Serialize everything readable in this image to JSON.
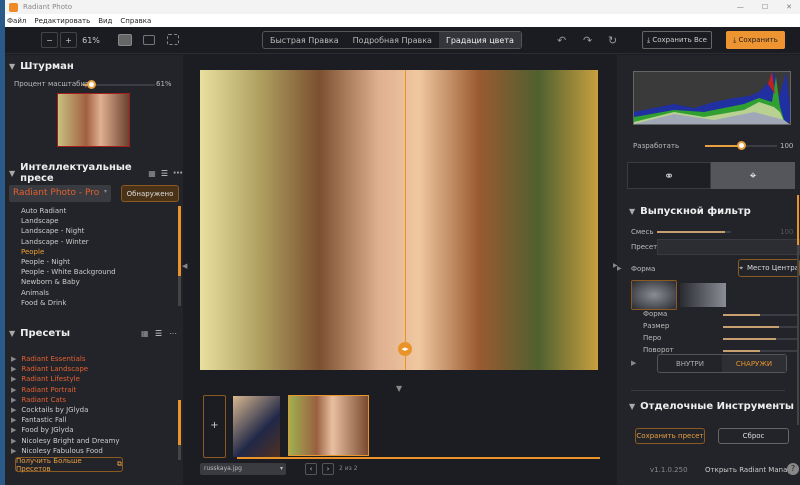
{
  "window": {
    "title": "Radiant Photo",
    "controls": [
      "—",
      "☐",
      "✕"
    ]
  },
  "menu": [
    "Файл",
    "Редактировать",
    "Вид",
    "Справка"
  ],
  "toolbar": {
    "zoom_out": "−",
    "zoom_in": "+",
    "zoom": "61%",
    "modes": [
      "Быстрая Правка",
      "Подробная Правка",
      "Градация цвета"
    ],
    "active_mode": 2,
    "save_all": "⤓ Сохранить Все",
    "save": "⤓ Сохранить"
  },
  "navigator": {
    "title": "Штурман",
    "zoom_label": "Процент масштабир",
    "zoom_value": "61%",
    "zoom_percent": 61
  },
  "smart_presets": {
    "title": "Интеллектуальные пресе",
    "dropdown": "Radiant Photo - Pro",
    "detected": "Обнаружено",
    "items": [
      "Auto Radiant",
      "Landscape",
      "Landscape - Night",
      "Landscape - Winter",
      "People",
      "People - Night",
      "People - White Background",
      "Newborn & Baby",
      "Animals",
      "Food & Drink"
    ],
    "selected": 4
  },
  "presets": {
    "title": "Пресеты",
    "items": [
      {
        "label": "Radiant Essentials",
        "highlight": true
      },
      {
        "label": "Radiant Landscape",
        "highlight": true
      },
      {
        "label": "Radiant Lifestyle",
        "highlight": true
      },
      {
        "label": "Radiant Portrait",
        "highlight": true
      },
      {
        "label": "Radiant Cats",
        "highlight": true
      },
      {
        "label": "Cocktails by JGlyda",
        "highlight": false
      },
      {
        "label": "Fantastic Fall",
        "highlight": false
      },
      {
        "label": "Food by JGlyda",
        "highlight": false
      },
      {
        "label": "Nicolesy Bright and Dreamy",
        "highlight": false
      },
      {
        "label": "Nicolesy Fabulous Food",
        "highlight": false
      }
    ],
    "get_more": "Получить Больше Пресетов"
  },
  "filmstrip": {
    "add": "+",
    "file": "russkaya.jpg",
    "counter": "2 из 2"
  },
  "right": {
    "develop_label": "Разработать",
    "develop_value": "100",
    "develop_percent": 50,
    "grad_filter": {
      "title": "Выпускной фильтр",
      "mix_label": "Смесь",
      "mix_value": "100",
      "preset_label": "Пресет",
      "shape_label": "Форма",
      "center_button": "Место Центра",
      "sliders": [
        {
          "label": "Форма",
          "value": 50
        },
        {
          "label": "Размер",
          "value": 75
        },
        {
          "label": "Перо",
          "value": 72
        },
        {
          "label": "Поворот",
          "value": 50
        }
      ],
      "inside": "ВНУТРИ",
      "outside": "СНАРУЖИ"
    },
    "finishing": {
      "title": "Отделочные Инструменты"
    },
    "save_preset": "Сохранить пресет",
    "reset": "Сброс",
    "version": "v1.1.0.250",
    "open_manager": "Открыть Radiant Manager",
    "help": "?"
  },
  "colors": {
    "accent": "#e8942a",
    "preset_highlight": "#e06030"
  }
}
